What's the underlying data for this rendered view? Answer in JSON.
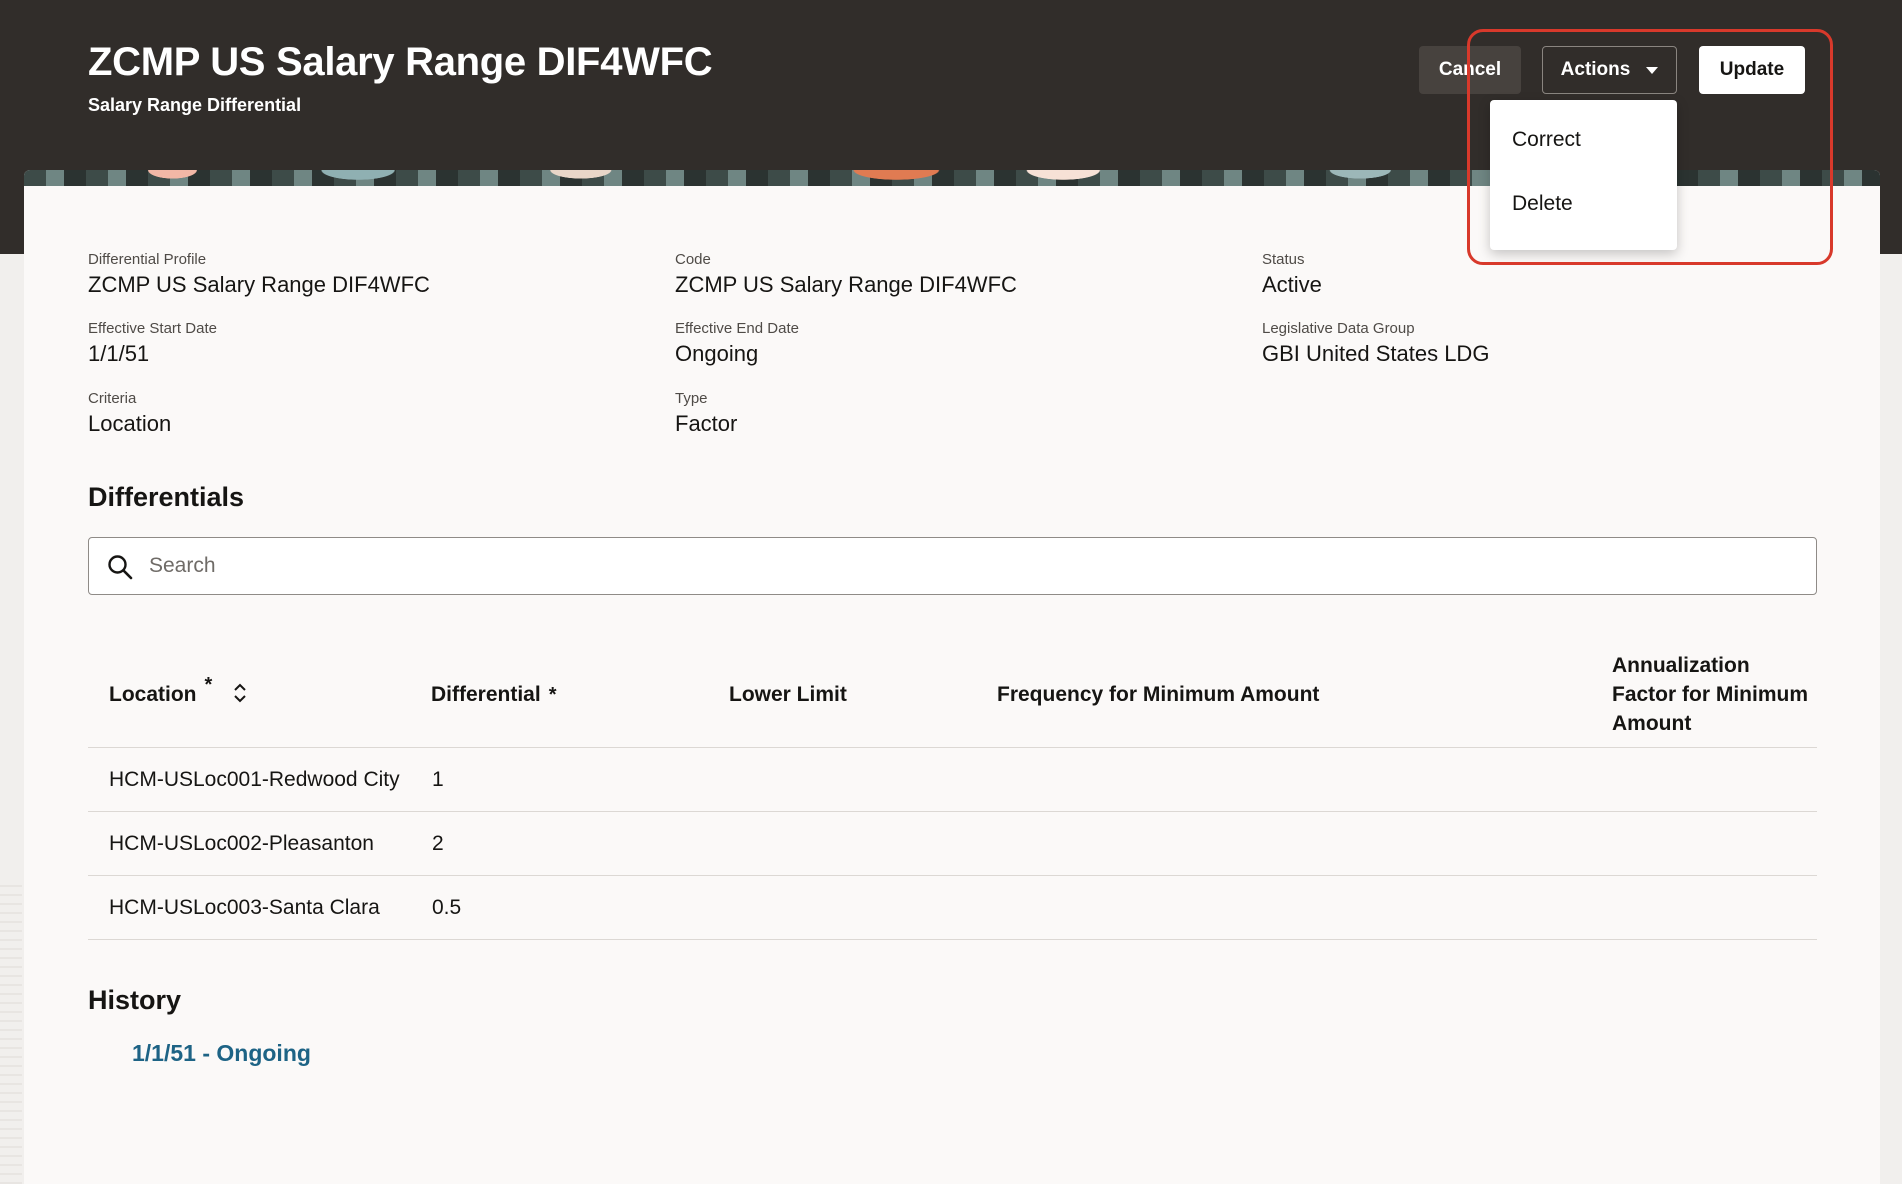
{
  "header": {
    "title": "ZCMP US Salary Range DIF4WFC",
    "subtitle": "Salary Range Differential",
    "buttons": {
      "cancel": "Cancel",
      "actions": "Actions",
      "update": "Update"
    },
    "actions_menu": [
      "Correct",
      "Delete"
    ]
  },
  "details": {
    "differential_profile": {
      "label": "Differential Profile",
      "value": "ZCMP US Salary Range DIF4WFC"
    },
    "code": {
      "label": "Code",
      "value": "ZCMP US Salary Range DIF4WFC"
    },
    "status": {
      "label": "Status",
      "value": "Active"
    },
    "effective_start_date": {
      "label": "Effective Start Date",
      "value": "1/1/51"
    },
    "effective_end_date": {
      "label": "Effective End Date",
      "value": "Ongoing"
    },
    "legislative_data_group": {
      "label": "Legislative Data Group",
      "value": "GBI United States LDG"
    },
    "criteria": {
      "label": "Criteria",
      "value": "Location"
    },
    "type": {
      "label": "Type",
      "value": "Factor"
    }
  },
  "differentials": {
    "title": "Differentials",
    "search_placeholder": "Search",
    "columns": {
      "location": "Location",
      "differential": "Differential",
      "lower_limit": "Lower Limit",
      "frequency": "Frequency for Minimum Amount",
      "annualization": "Annualization Factor for Minimum Amount",
      "required_mark": "*"
    },
    "rows": [
      {
        "location": "HCM-USLoc001-Redwood City",
        "differential": "1"
      },
      {
        "location": "HCM-USLoc002-Pleasanton",
        "differential": "2"
      },
      {
        "location": "HCM-USLoc003-Santa Clara",
        "differential": "0.5"
      }
    ]
  },
  "history": {
    "title": "History",
    "link": "1/1/51 - Ongoing"
  }
}
